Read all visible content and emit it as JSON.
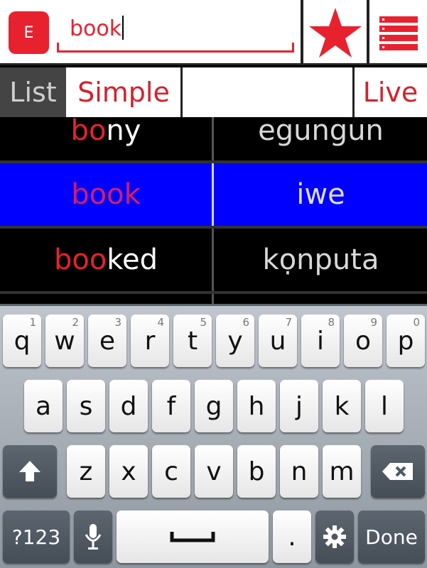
{
  "app": {
    "lang_button": "E",
    "search": {
      "value": "book"
    }
  },
  "tabs": {
    "list": "List",
    "simple": "Simple",
    "live": "Live"
  },
  "colors": {
    "accent": "#e8212f",
    "selected_row": "#0000ff"
  },
  "results": [
    {
      "match": "bo",
      "rest": "ny",
      "translation": "egungun",
      "selected": false
    },
    {
      "match": "book",
      "rest": "",
      "translation": "iwe",
      "selected": true
    },
    {
      "match": "boo",
      "rest": "ked",
      "translation": "kọnputa",
      "selected": false
    }
  ],
  "keyboard": {
    "row1": [
      {
        "key": "q",
        "hint": "1"
      },
      {
        "key": "w",
        "hint": "2"
      },
      {
        "key": "e",
        "hint": "3"
      },
      {
        "key": "r",
        "hint": "4"
      },
      {
        "key": "t",
        "hint": "5"
      },
      {
        "key": "y",
        "hint": "6"
      },
      {
        "key": "u",
        "hint": "7"
      },
      {
        "key": "i",
        "hint": "8"
      },
      {
        "key": "o",
        "hint": "9"
      },
      {
        "key": "p",
        "hint": "0"
      }
    ],
    "row2": [
      "a",
      "s",
      "d",
      "f",
      "g",
      "h",
      "j",
      "k",
      "l"
    ],
    "row3": [
      "z",
      "x",
      "c",
      "v",
      "b",
      "n",
      "m"
    ],
    "symbols": "?123",
    "period": ".",
    "done": "Done",
    "icons": {
      "shift": "shift-arrow-icon",
      "delete": "backspace-icon",
      "mic": "microphone-icon",
      "space": "spacebar-icon",
      "settings": "gear-icon"
    }
  }
}
